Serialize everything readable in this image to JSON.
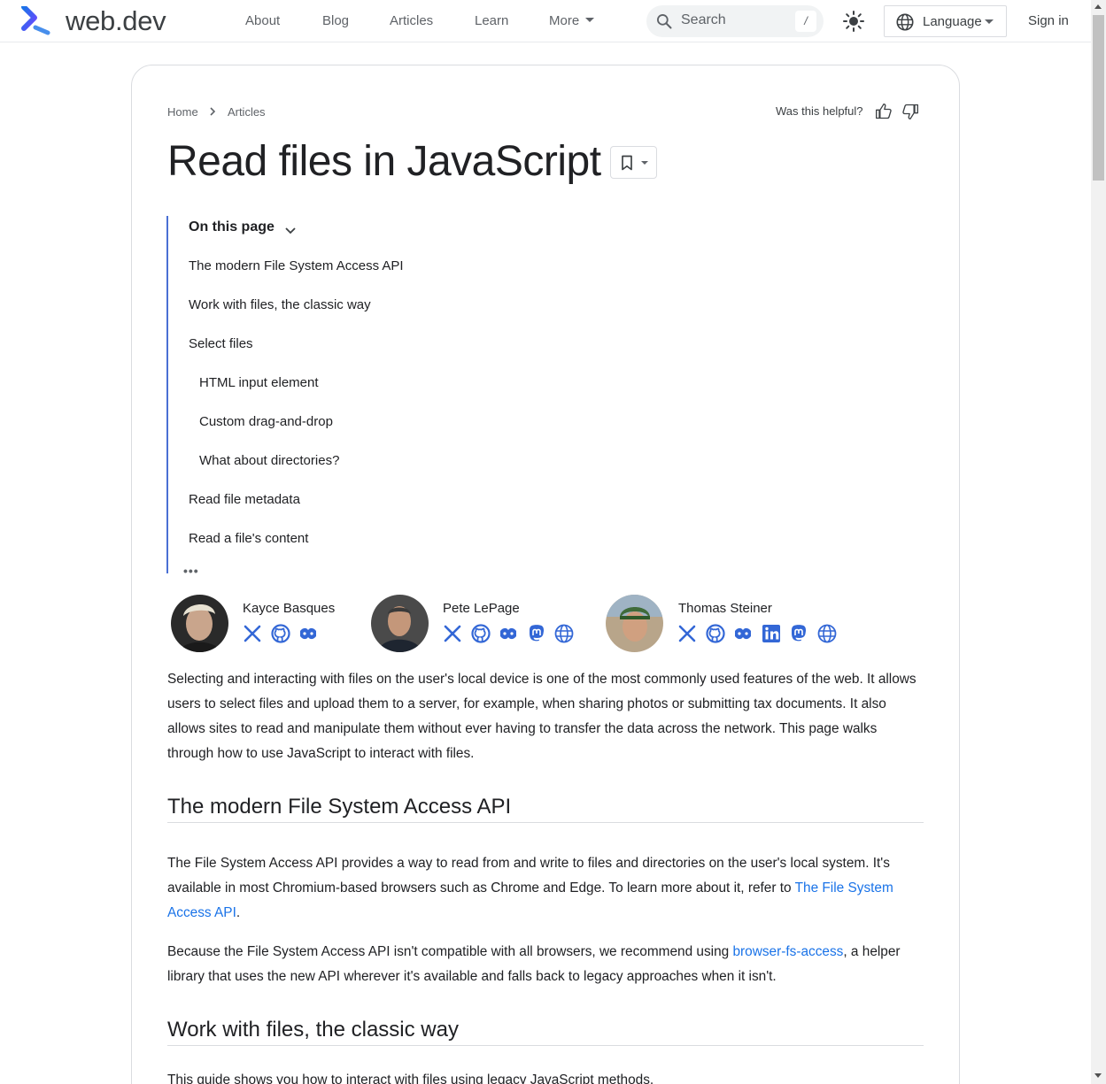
{
  "site": {
    "name": "web.dev"
  },
  "nav": {
    "items": [
      "About",
      "Blog",
      "Articles",
      "Learn",
      "More"
    ]
  },
  "search": {
    "placeholder": "Search",
    "shortcut": "/"
  },
  "language": {
    "label": "Language"
  },
  "signin": {
    "label": "Sign in"
  },
  "breadcrumb": {
    "items": [
      "Home",
      "Articles"
    ]
  },
  "feedback": {
    "question": "Was this helpful?"
  },
  "page": {
    "title": "Read files in JavaScript"
  },
  "toc": {
    "heading": "On this page",
    "items": [
      "The modern File System Access API",
      "Work with files, the classic way",
      "Select files",
      "HTML input element",
      "Custom drag-and-drop",
      "What about directories?",
      "Read file metadata",
      "Read a file's content"
    ],
    "more": "•••"
  },
  "authors": [
    {
      "name": "Kayce Basques",
      "links": [
        "x-icon",
        "github-icon",
        "glitch-icon"
      ]
    },
    {
      "name": "Pete LePage",
      "links": [
        "x-icon",
        "github-icon",
        "glitch-icon",
        "mastodon-icon",
        "globe-icon"
      ]
    },
    {
      "name": "Thomas Steiner",
      "links": [
        "x-icon",
        "github-icon",
        "glitch-icon",
        "linkedin-icon",
        "mastodon-icon",
        "globe-icon"
      ]
    }
  ],
  "content": {
    "intro": "Selecting and interacting with files on the user's local device is one of the most commonly used features of the web. It allows users to select files and upload them to a server, for example, when sharing photos or submitting tax documents. It also allows sites to read and manipulate them without ever having to transfer the data across the network. This page walks through how to use JavaScript to interact with files.",
    "h2_1": "The modern File System Access API",
    "p1_a": "The File System Access API provides a way to read from and write to files and directories on the user's local system. It's available in most Chromium-based browsers such as Chrome and Edge. To learn more about it, refer to ",
    "p1_link": "The File System Access API",
    "p1_b": ".",
    "p2_a": "Because the File System Access API isn't compatible with all browsers, we recommend using ",
    "p2_link": "browser-fs-access",
    "p2_b": ", a helper library that uses the new API wherever it's available and falls back to legacy approaches when it isn't.",
    "h2_2": "Work with files, the classic way",
    "p3": "This guide shows you how to interact with files using legacy JavaScript methods."
  },
  "colors": {
    "accent": "#1a73e8",
    "social": "#3367d6",
    "toc_border": "#4a6fd4"
  }
}
